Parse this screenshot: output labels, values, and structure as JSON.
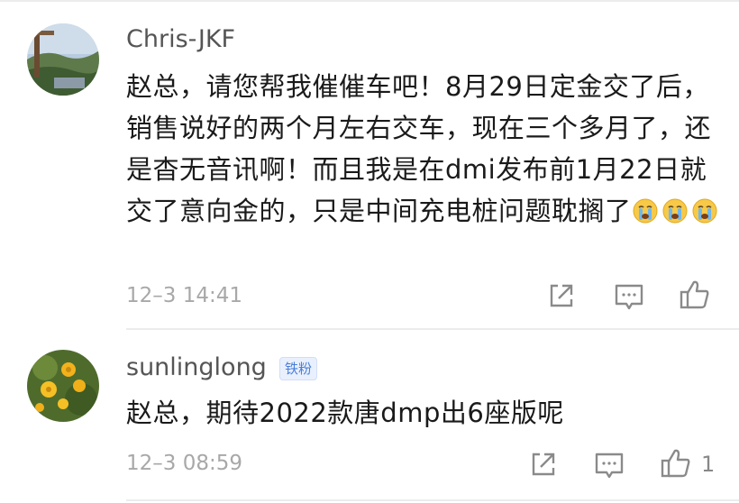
{
  "comments": [
    {
      "username": "Chris-JKF",
      "badge": "",
      "text": "赵总，请您帮我催催车吧！8月29日定金交了后，销售说好的两个月左右交车，现在三个多月了，还是杳无音讯啊！而且我是在dmi发布前1月22日就交了意向金的，只是中间充电桩问题耽搁了",
      "emojis": [
        "crying-face-emoji",
        "crying-face-emoji",
        "crying-face-emoji"
      ],
      "time": "12–3 14:41",
      "like_count": ""
    },
    {
      "username": "sunlinglong",
      "badge": "铁粉",
      "text": "赵总，期待2022款唐dmp出6座版呢",
      "emojis": [],
      "time": "12–3 08:59",
      "like_count": "1"
    }
  ],
  "colors": {
    "text": "#1a1a1a",
    "username": "#555555",
    "meta": "#a8a8a8",
    "badge_bg": "#e9f0fd",
    "badge_text": "#4a7fd8",
    "icon": "#8a8a8a"
  }
}
